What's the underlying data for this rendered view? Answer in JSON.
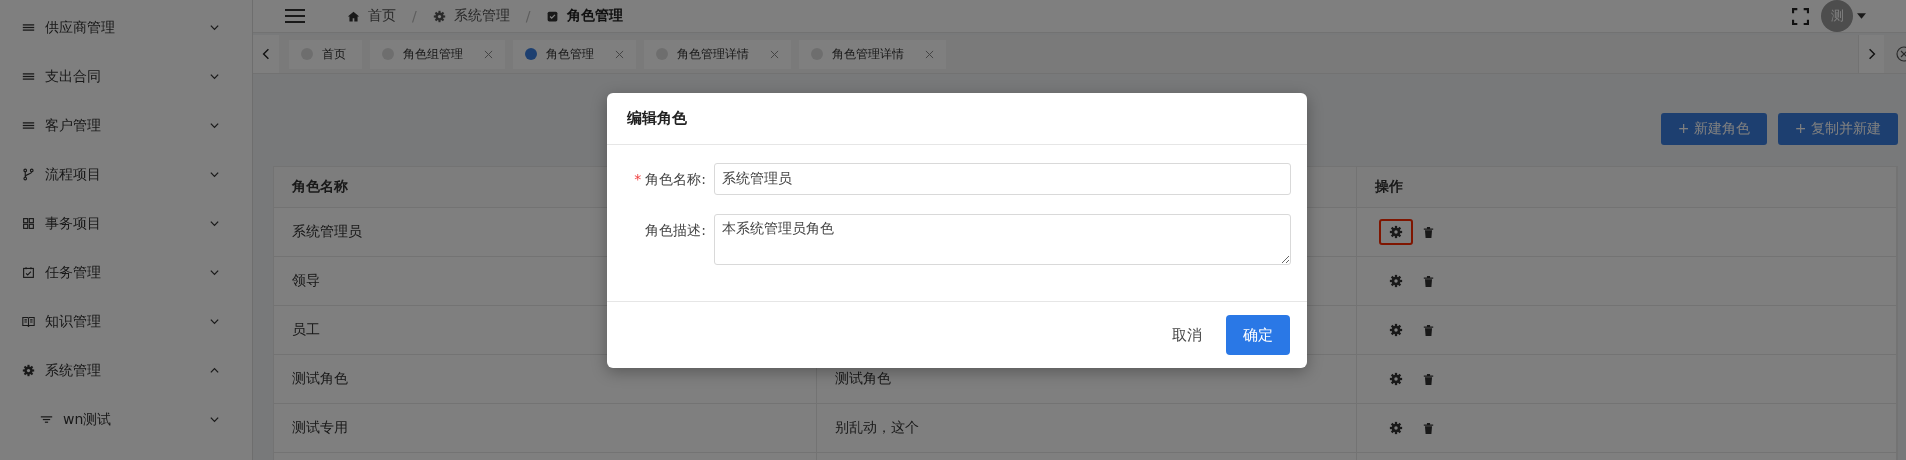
{
  "sidebar": {
    "items": [
      {
        "label": "供应商管理",
        "kind": "list",
        "expanded": false
      },
      {
        "label": "支出合同",
        "kind": "list",
        "expanded": false
      },
      {
        "label": "客户管理",
        "kind": "list",
        "expanded": false
      },
      {
        "label": "流程项目",
        "kind": "branch",
        "expanded": false
      },
      {
        "label": "事务项目",
        "kind": "grid",
        "expanded": false
      },
      {
        "label": "任务管理",
        "kind": "calendar",
        "expanded": false
      },
      {
        "label": "知识管理",
        "kind": "book",
        "expanded": false
      },
      {
        "label": "系统管理",
        "kind": "gear",
        "expanded": true,
        "children": [
          {
            "label": "wn测试",
            "kind": "filter",
            "expanded": false
          }
        ]
      }
    ]
  },
  "header": {
    "breadcrumb": [
      {
        "label": "首页",
        "kind": "home"
      },
      {
        "label": "系统管理",
        "kind": "gear"
      },
      {
        "label": "角色管理",
        "kind": "check"
      }
    ],
    "separators": [
      "/",
      "/"
    ],
    "avatar": "测"
  },
  "tabs": [
    {
      "label": "首页",
      "selected": false,
      "closable": false
    },
    {
      "label": "角色组管理",
      "selected": false,
      "closable": true
    },
    {
      "label": "角色管理",
      "selected": true,
      "closable": true
    },
    {
      "label": "角色管理详情",
      "selected": false,
      "closable": true
    },
    {
      "label": "角色管理详情",
      "selected": false,
      "closable": true
    }
  ],
  "toolbar": {
    "buttons": [
      "+ 新建角色",
      "+ 复制并新建"
    ]
  },
  "table": {
    "columns": [
      "角色名称",
      "",
      "操作"
    ],
    "rows": [
      {
        "name": "系统管理员",
        "highlighted": true
      },
      {
        "name": "领导",
        "highlighted": false
      },
      {
        "name": "员工",
        "highlighted": false
      },
      {
        "name": "测试角色",
        "description": "测试角色",
        "highlighted": false
      },
      {
        "name": "测试专用",
        "description": "别乱动，这个",
        "highlighted": false
      }
    ]
  },
  "dialog": {
    "title": "编辑角色",
    "fields": [
      {
        "label": "角色名称:",
        "value": "系统管理员",
        "required_mark": "*",
        "kind": "input"
      },
      {
        "label": "角色描述:",
        "value": "本系统管理员角色",
        "kind": "textarea"
      }
    ],
    "cancel": "取消",
    "confirm": "确定"
  }
}
